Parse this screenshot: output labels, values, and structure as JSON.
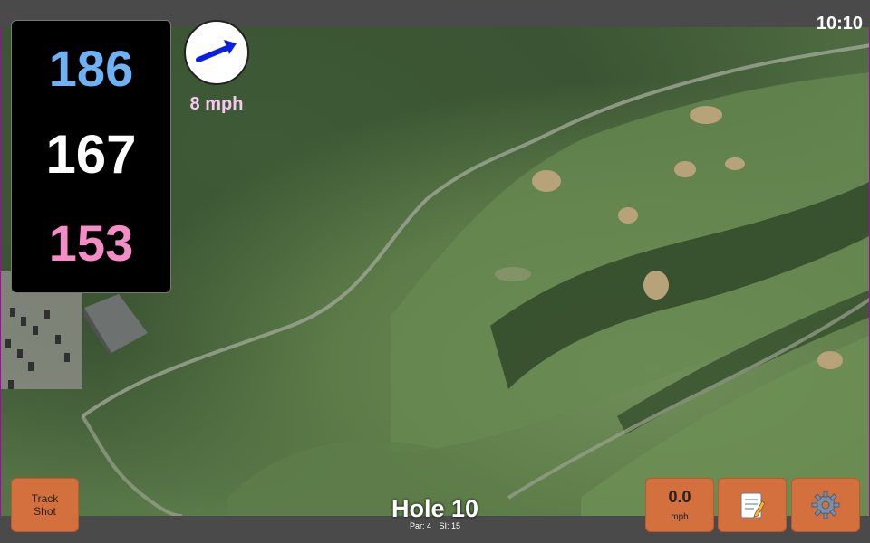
{
  "status_bar": {
    "clock": "10:10"
  },
  "distances": {
    "back": "186",
    "middle": "167",
    "front": "153"
  },
  "wind": {
    "speed": "8 mph",
    "icon": "wind-arrow-icon"
  },
  "hole": {
    "title": "Hole 10",
    "par": "Par: 4",
    "si": "SI: 15"
  },
  "buttons": {
    "track_shot": "Track Shot",
    "speed_value": "0.0",
    "speed_unit": "mph",
    "notes_icon": "notepad-icon",
    "settings_icon": "gear-icon"
  },
  "colors": {
    "back": "#6db2f5",
    "middle": "#ffffff",
    "front": "#f48cc6",
    "button": "#d4703e",
    "wind_arrow": "#0b1fe0"
  }
}
